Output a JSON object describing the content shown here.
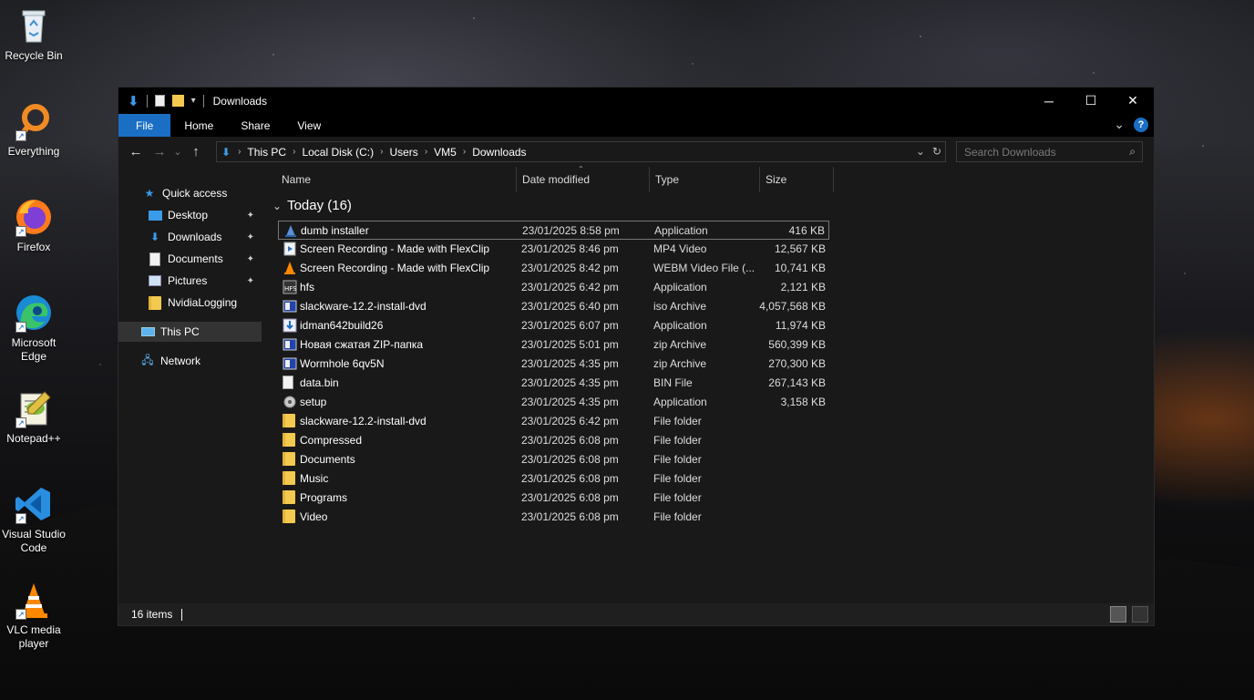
{
  "desktop": {
    "icons": [
      {
        "label": "Recycle Bin",
        "icon": "recycle-bin-icon"
      },
      {
        "label": "Everything",
        "icon": "everything-search-icon"
      },
      {
        "label": "Firefox",
        "icon": "firefox-icon"
      },
      {
        "label": "Microsoft Edge",
        "icon": "edge-icon"
      },
      {
        "label": "Notepad++",
        "icon": "notepadpp-icon"
      },
      {
        "label": "Visual Studio Code",
        "icon": "vscode-icon"
      },
      {
        "label": "VLC media player",
        "icon": "vlc-icon"
      }
    ]
  },
  "window": {
    "title": "Downloads",
    "controls": {
      "minimize": "─",
      "maximize": "☐",
      "close": "✕"
    }
  },
  "ribbon": {
    "tabs": [
      "File",
      "Home",
      "Share",
      "View"
    ],
    "expand_glyph": "⌄",
    "help_glyph": "?"
  },
  "navigation": {
    "back": "←",
    "forward": "→",
    "recent": "⌄",
    "up": "↑",
    "breadcrumb": [
      "This PC",
      "Local Disk (C:)",
      "Users",
      "VM5",
      "Downloads"
    ],
    "dropdown_glyph": "⌄",
    "refresh_glyph": "↻"
  },
  "search": {
    "placeholder": "Search Downloads",
    "icon": "⌕"
  },
  "nav_pane": {
    "quick_access": "Quick access",
    "quick_items": [
      {
        "label": "Desktop",
        "icon": "desktop-folder-icon",
        "pinned": true
      },
      {
        "label": "Downloads",
        "icon": "downloads-folder-icon",
        "pinned": true
      },
      {
        "label": "Documents",
        "icon": "documents-folder-icon",
        "pinned": true
      },
      {
        "label": "Pictures",
        "icon": "pictures-folder-icon",
        "pinned": true
      },
      {
        "label": "NvidiaLogging",
        "icon": "folder-icon",
        "pinned": false
      }
    ],
    "this_pc": "This PC",
    "network": "Network",
    "pin_glyph": "📌"
  },
  "columns": {
    "name": "Name",
    "date": "Date modified",
    "type": "Type",
    "size": "Size",
    "sort_caret": "⌃"
  },
  "group": {
    "label": "Today (16)",
    "chevron": "⌄"
  },
  "files": [
    {
      "name": "dumb installer",
      "date": "23/01/2025 8:58 pm",
      "type": "Application",
      "size": "416 KB",
      "icon": "installer-icon",
      "selected": true
    },
    {
      "name": "Screen Recording - Made with FlexClip",
      "date": "23/01/2025 8:46 pm",
      "type": "MP4 Video",
      "size": "12,567 KB",
      "icon": "video-file-icon"
    },
    {
      "name": "Screen Recording - Made with FlexClip",
      "date": "23/01/2025 8:42 pm",
      "type": "WEBM Video File (...",
      "size": "10,741 KB",
      "icon": "vlc-file-icon"
    },
    {
      "name": "hfs",
      "date": "23/01/2025 6:42 pm",
      "type": "Application",
      "size": "2,121 KB",
      "icon": "hfs-app-icon"
    },
    {
      "name": "slackware-12.2-install-dvd",
      "date": "23/01/2025 6:40 pm",
      "type": "iso Archive",
      "size": "4,057,568 KB",
      "icon": "archive-icon"
    },
    {
      "name": "idman642build26",
      "date": "23/01/2025 6:07 pm",
      "type": "Application",
      "size": "11,974 KB",
      "icon": "idm-app-icon"
    },
    {
      "name": "Новая сжатая ZIP-папка",
      "date": "23/01/2025 5:01 pm",
      "type": "zip Archive",
      "size": "560,399 KB",
      "icon": "archive-icon"
    },
    {
      "name": "Wormhole 6qv5N",
      "date": "23/01/2025 4:35 pm",
      "type": "zip Archive",
      "size": "270,300 KB",
      "icon": "archive-icon"
    },
    {
      "name": "data.bin",
      "date": "23/01/2025 4:35 pm",
      "type": "BIN File",
      "size": "267,143 KB",
      "icon": "blank-file-icon"
    },
    {
      "name": "setup",
      "date": "23/01/2025 4:35 pm",
      "type": "Application",
      "size": "3,158 KB",
      "icon": "setup-app-icon"
    },
    {
      "name": "slackware-12.2-install-dvd",
      "date": "23/01/2025 6:42 pm",
      "type": "File folder",
      "size": "",
      "icon": "folder-icon"
    },
    {
      "name": "Compressed",
      "date": "23/01/2025 6:08 pm",
      "type": "File folder",
      "size": "",
      "icon": "folder-icon"
    },
    {
      "name": "Documents",
      "date": "23/01/2025 6:08 pm",
      "type": "File folder",
      "size": "",
      "icon": "folder-icon"
    },
    {
      "name": "Music",
      "date": "23/01/2025 6:08 pm",
      "type": "File folder",
      "size": "",
      "icon": "folder-icon"
    },
    {
      "name": "Programs",
      "date": "23/01/2025 6:08 pm",
      "type": "File folder",
      "size": "",
      "icon": "folder-icon"
    },
    {
      "name": "Video",
      "date": "23/01/2025 6:08 pm",
      "type": "File folder",
      "size": "",
      "icon": "folder-icon"
    }
  ],
  "status": {
    "item_count": "16 items"
  },
  "colors": {
    "accent": "#1a6fc4",
    "window_bg": "#191919",
    "folder": "#f4c950"
  }
}
